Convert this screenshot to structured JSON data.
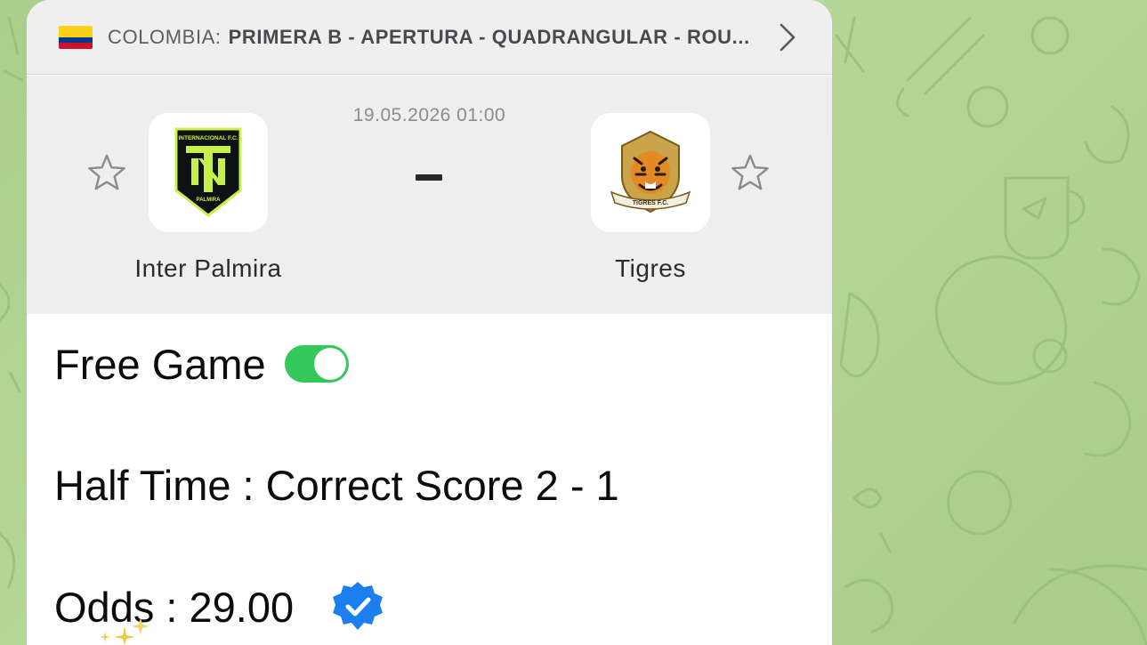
{
  "colors": {
    "background": "#afd391",
    "doodle": "#97c07a",
    "toggle_on": "#34c759",
    "verified_badge": "#1d7ef0"
  },
  "league": {
    "country_label": "COLOMBIA:",
    "name": "PRIMERA B - APERTURA - QUADRANGULAR - ROU...",
    "flag_icon": "colombia-flag-icon",
    "chevron_icon": "chevron-right-icon"
  },
  "match": {
    "datetime": "19.05.2026 01:00",
    "score": "-",
    "home": {
      "name": "Inter Palmira",
      "logo_text_top": "INTERNACIONAL F.C.",
      "logo_text_bottom": "PALMIRA",
      "favorite_icon": "star-outline-icon"
    },
    "away": {
      "name": "Tigres",
      "logo_text": "TIGRES F.C.",
      "favorite_icon": "star-outline-icon"
    }
  },
  "tips": {
    "free_game": "Free Game",
    "free_game_toggle_on": true,
    "half_time": "Half Time : Correct Score 2 - 1",
    "odds": "Odds : 29.00",
    "verified_icon": "verified-badge-icon",
    "sparkles_icon": "sparkles-icon"
  }
}
